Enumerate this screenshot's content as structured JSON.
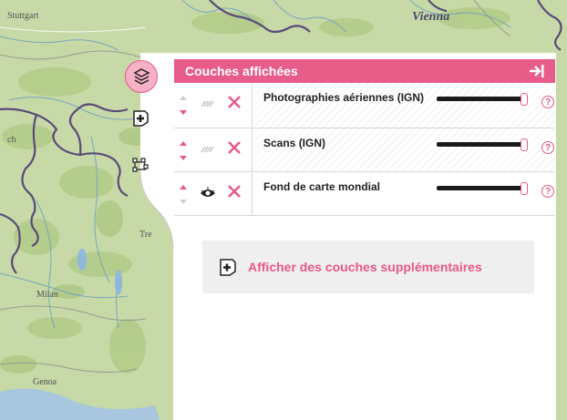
{
  "map": {
    "labels": {
      "stuttgart": "Stuttgart",
      "vienna": "Vienna",
      "milan": "Milan",
      "genoa": "Genoa",
      "tr": "Tre",
      "ch": "ch"
    }
  },
  "sidebar": {
    "items": [
      {
        "name": "layers-icon",
        "active": true
      },
      {
        "name": "add-document-icon",
        "active": false
      },
      {
        "name": "draw-tools-icon",
        "active": false
      }
    ]
  },
  "panel": {
    "title": "Couches affichées",
    "layers": [
      {
        "name": "Photographies aériennes (IGN)",
        "visibility": "hidden",
        "opacity": 1.0,
        "up_enabled": false,
        "down_enabled": true,
        "help": "?"
      },
      {
        "name": "Scans (IGN)",
        "visibility": "hidden",
        "opacity": 1.0,
        "up_enabled": true,
        "down_enabled": true,
        "help": "?"
      },
      {
        "name": "Fond de carte mondial",
        "visibility": "visible",
        "opacity": 1.0,
        "up_enabled": true,
        "down_enabled": false,
        "help": "?"
      }
    ],
    "add_layers_label": "Afficher des couches supplémentaires"
  },
  "colors": {
    "accent": "#e85c8a",
    "map_land": "#c6d9a6",
    "border_purple": "#5a4a7a",
    "river_blue": "#6a9ac8"
  }
}
